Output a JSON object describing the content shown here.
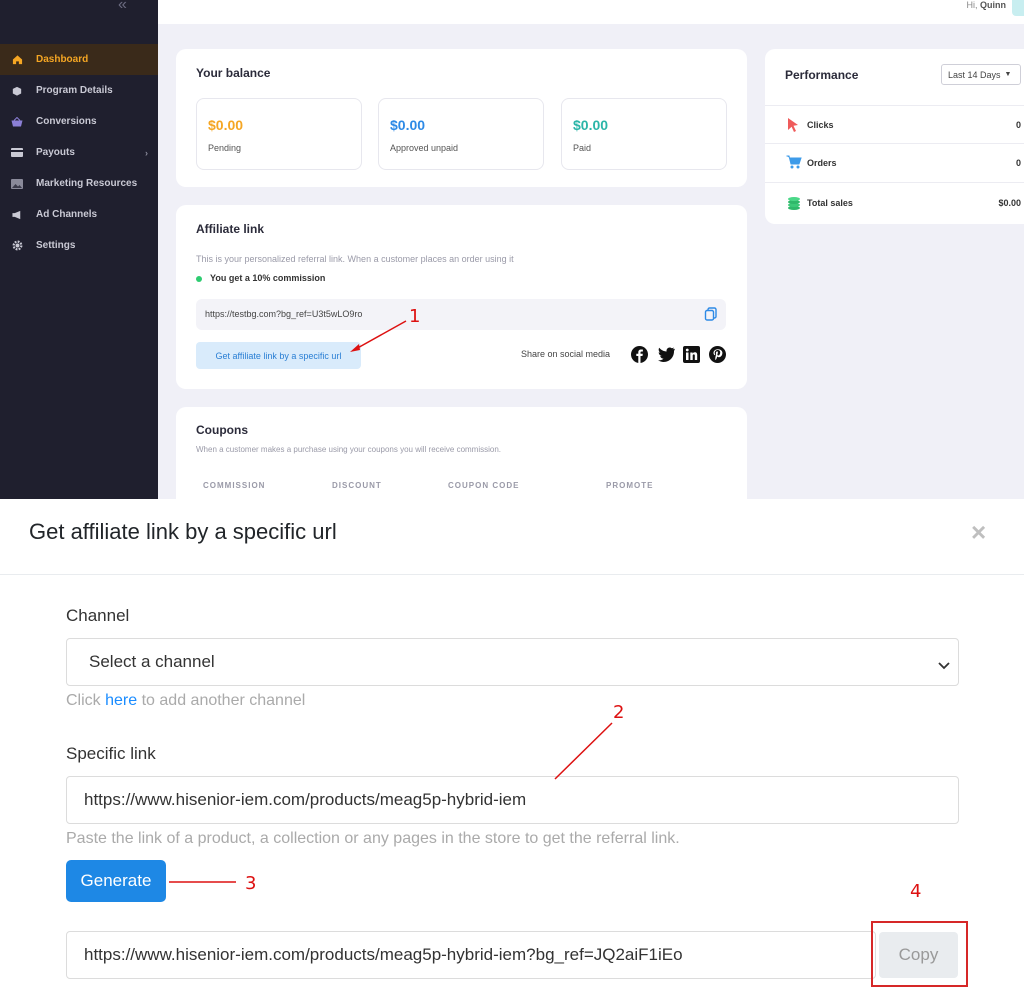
{
  "user": {
    "greeting": "Hi,",
    "name": "Quinn"
  },
  "sidebar": {
    "items": [
      {
        "label": "Dashboard",
        "icon": "home-icon"
      },
      {
        "label": "Program Details",
        "icon": "box-icon"
      },
      {
        "label": "Conversions",
        "icon": "basket-icon"
      },
      {
        "label": "Payouts",
        "icon": "wallet-icon"
      },
      {
        "label": "Marketing Resources",
        "icon": "image-icon"
      },
      {
        "label": "Ad Channels",
        "icon": "megaphone-icon"
      },
      {
        "label": "Settings",
        "icon": "gear-icon"
      }
    ]
  },
  "balance": {
    "title": "Your balance",
    "boxes": [
      {
        "amount": "$0.00",
        "label": "Pending",
        "color": "#f5a623"
      },
      {
        "amount": "$0.00",
        "label": "Approved unpaid",
        "color": "#2d8ae6"
      },
      {
        "amount": "$0.00",
        "label": "Paid",
        "color": "#2bb5a8"
      }
    ]
  },
  "affiliate": {
    "title": "Affiliate link",
    "description": "This is your personalized referral link. When a customer places an order using it",
    "commission": "You get a 10% commission",
    "link": "https://testbg.com?bg_ref=U3t5wLO9ro",
    "specific_button": "Get affiliate link by a specific url",
    "share_label": "Share on social media"
  },
  "coupons": {
    "title": "Coupons",
    "description": "When a customer makes a purchase using your coupons you will receive commission.",
    "columns": [
      "COMMISSION",
      "DISCOUNT",
      "COUPON CODE",
      "PROMOTE"
    ]
  },
  "performance": {
    "title": "Performance",
    "range": "Last 14 Days",
    "rows": [
      {
        "label": "Clicks",
        "value": "0",
        "icon": "cursor-icon"
      },
      {
        "label": "Orders",
        "value": "0",
        "icon": "cart-icon"
      },
      {
        "label": "Total sales",
        "value": "$0.00",
        "icon": "coins-icon"
      }
    ]
  },
  "annotations": [
    "1",
    "2",
    "3",
    "4"
  ],
  "modal": {
    "title": "Get affiliate link by a specific url",
    "channel_label": "Channel",
    "channel_placeholder": "Select a channel",
    "channel_help_prefix": "Click",
    "channel_help_link": "here",
    "channel_help_suffix": "to add another channel",
    "specific_label": "Specific link",
    "specific_value": "https://www.hisenior-iem.com/products/meag5p-hybrid-iem",
    "specific_help": "Paste the link of a product, a collection or any pages in the store to get the referral link.",
    "generate_label": "Generate",
    "result_value": "https://www.hisenior-iem.com/products/meag5p-hybrid-iem?bg_ref=JQ2aiF1iEo",
    "copy_label": "Copy"
  }
}
